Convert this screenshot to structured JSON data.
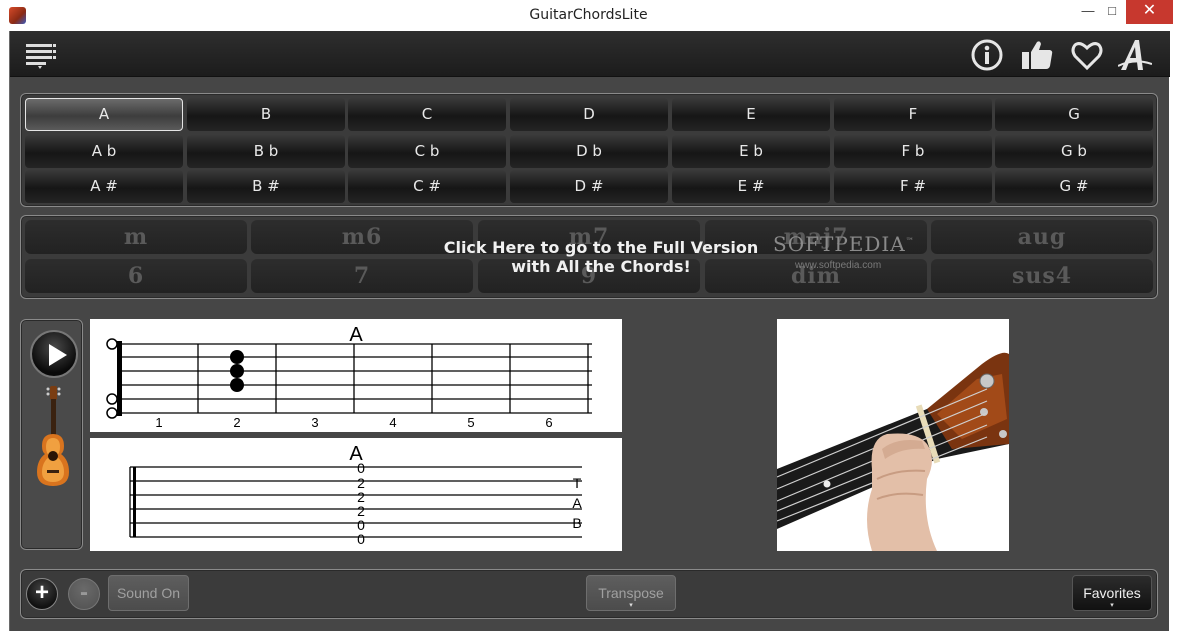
{
  "window": {
    "title": "GuitarChordsLite",
    "min_glyph": "—",
    "max_glyph": "□",
    "close_glyph": "✕"
  },
  "toolbar": {
    "icons": [
      "menu-icon",
      "info-icon",
      "thumbs-up-icon",
      "heart-icon",
      "font-icon"
    ]
  },
  "keys": {
    "row1": [
      "A",
      "B",
      "C",
      "D",
      "E",
      "F",
      "G"
    ],
    "row2": [
      "A b",
      "B b",
      "C b",
      "D b",
      "E b",
      "F b",
      "G b"
    ],
    "row3": [
      "A #",
      "B #",
      "C #",
      "D #",
      "E #",
      "F #",
      "G #"
    ],
    "selected": "A"
  },
  "types": {
    "row1": [
      "m",
      "m6",
      "m7",
      "maj7",
      "aug"
    ],
    "row2": [
      "6",
      "7",
      "9",
      "dim",
      "sus4"
    ],
    "promo_line1": "Click Here to go to the Full Version",
    "promo_line2": "with All the Chords!",
    "watermark": "SOFTPEDIA",
    "watermark_tm": "™",
    "watermark_url": "www.softpedia.com"
  },
  "diagram": {
    "chord": "A",
    "frets": [
      "1",
      "2",
      "3",
      "4",
      "5",
      "6"
    ]
  },
  "tab": {
    "chord": "A",
    "values": [
      "0",
      "2",
      "2",
      "2",
      "0",
      "0"
    ],
    "side_letters": [
      "T",
      "A",
      "B"
    ]
  },
  "bottom": {
    "plus": "+",
    "minus": "-",
    "sound": "Sound On",
    "transpose": "Transpose",
    "favorites": "Favorites",
    "caret": "▾"
  },
  "colors": {
    "app_bg": "#464646",
    "close_button": "#c7382e"
  }
}
